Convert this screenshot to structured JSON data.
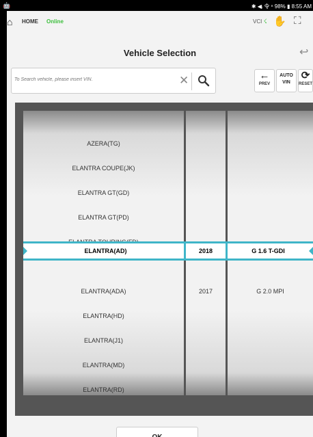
{
  "status_bar": {
    "left_icon": "android-icon",
    "right_text": "✱ ◀ᵢ 令 ⁿ 98% ▮ 8:55 AM"
  },
  "home_bar": {
    "home_label": "HOME",
    "status": "Online",
    "vci_label": "VCI"
  },
  "title": "Vehicle Selection",
  "search": {
    "placeholder": "To Search vehicle, please insert VIN."
  },
  "toolbar": {
    "prev_label": "PREV",
    "auto_vin_top": "AUTO",
    "auto_vin_bottom": "VIN",
    "reset_label": "RESET"
  },
  "picker": {
    "models": [
      "AZERA(TG)",
      "ELANTRA COUPE(JK)",
      "ELANTRA GT(GD)",
      "ELANTRA GT(PD)",
      "ELANTRA TOURING(FD)",
      "ELANTRA(AD)",
      "ELANTRA(ADA)",
      "ELANTRA(HD)",
      "ELANTRA(J1)",
      "ELANTRA(MD)",
      "ELANTRA(RD)"
    ],
    "years": [
      "2018",
      "2017"
    ],
    "engines": [
      "G 1.6 T-GDI",
      "G 2.0 MPI"
    ],
    "selected": {
      "model": "ELANTRA(AD)",
      "year": "2018",
      "engine": "G 1.6 T-GDI"
    }
  },
  "ok_label": "OK",
  "colors": {
    "accent": "#3fb5c8",
    "online": "#3cbf3c"
  }
}
